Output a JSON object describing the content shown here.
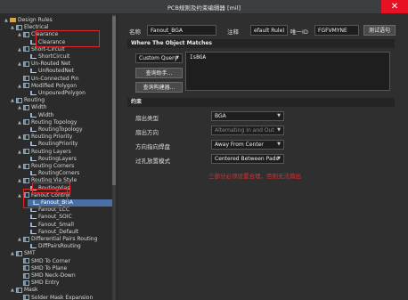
{
  "window": {
    "title": "PCB规则及约束编辑器 [mil]",
    "close_symbol": "✕"
  },
  "tree": [
    {
      "label": "Design Rules",
      "level": 0,
      "twisty": "▲",
      "icon": "folder-icon"
    },
    {
      "label": "Electrical",
      "level": 1,
      "twisty": "▲",
      "icon": "category-icon"
    },
    {
      "label": "Clearance",
      "level": 2,
      "twisty": "▲",
      "icon": "rule-category-icon"
    },
    {
      "label": "Clearance",
      "level": 3,
      "twisty": "",
      "icon": "rule-icon"
    },
    {
      "label": "Short-Circuit",
      "level": 2,
      "twisty": "▲",
      "icon": "rule-category-icon"
    },
    {
      "label": "ShortCircuit",
      "level": 3,
      "twisty": "",
      "icon": "rule-icon"
    },
    {
      "label": "Un-Routed Net",
      "level": 2,
      "twisty": "▲",
      "icon": "rule-category-icon"
    },
    {
      "label": "UnRoutedNet",
      "level": 3,
      "twisty": "",
      "icon": "rule-icon"
    },
    {
      "label": "Un-Connected Pin",
      "level": 2,
      "twisty": "",
      "icon": "rule-category-icon"
    },
    {
      "label": "Modified Polygon",
      "level": 2,
      "twisty": "▲",
      "icon": "rule-category-icon"
    },
    {
      "label": "UnpouredPolygon",
      "level": 3,
      "twisty": "",
      "icon": "rule-icon"
    },
    {
      "label": "Routing",
      "level": 1,
      "twisty": "▲",
      "icon": "category-icon"
    },
    {
      "label": "Width",
      "level": 2,
      "twisty": "▲",
      "icon": "rule-category-icon"
    },
    {
      "label": "Width",
      "level": 3,
      "twisty": "",
      "icon": "rule-icon"
    },
    {
      "label": "Routing Topology",
      "level": 2,
      "twisty": "▲",
      "icon": "rule-category-icon"
    },
    {
      "label": "RoutingTopology",
      "level": 3,
      "twisty": "",
      "icon": "rule-icon"
    },
    {
      "label": "Routing Priority",
      "level": 2,
      "twisty": "▲",
      "icon": "rule-category-icon"
    },
    {
      "label": "RoutingPriority",
      "level": 3,
      "twisty": "",
      "icon": "rule-icon"
    },
    {
      "label": "Routing Layers",
      "level": 2,
      "twisty": "▲",
      "icon": "rule-category-icon"
    },
    {
      "label": "RoutingLayers",
      "level": 3,
      "twisty": "",
      "icon": "rule-icon"
    },
    {
      "label": "Routing Corners",
      "level": 2,
      "twisty": "▲",
      "icon": "rule-category-icon"
    },
    {
      "label": "RoutingCorners",
      "level": 3,
      "twisty": "",
      "icon": "rule-icon"
    },
    {
      "label": "Routing Via Style",
      "level": 2,
      "twisty": "▲",
      "icon": "rule-category-icon"
    },
    {
      "label": "RoutingVias",
      "level": 3,
      "twisty": "",
      "icon": "rule-icon"
    },
    {
      "label": "Fanout Control",
      "level": 2,
      "twisty": "▲",
      "icon": "rule-category-icon"
    },
    {
      "label": "Fanout_BGA",
      "level": 3,
      "twisty": "",
      "icon": "rule-icon",
      "selected": true
    },
    {
      "label": "Fanout_LCC",
      "level": 3,
      "twisty": "",
      "icon": "rule-icon"
    },
    {
      "label": "Fanout_SOIC",
      "level": 3,
      "twisty": "",
      "icon": "rule-icon"
    },
    {
      "label": "Fanout_Small",
      "level": 3,
      "twisty": "",
      "icon": "rule-icon"
    },
    {
      "label": "Fanout_Default",
      "level": 3,
      "twisty": "",
      "icon": "rule-icon"
    },
    {
      "label": "Differential Pairs Routing",
      "level": 2,
      "twisty": "▲",
      "icon": "rule-category-icon"
    },
    {
      "label": "DiffPairsRouting",
      "level": 3,
      "twisty": "",
      "icon": "rule-icon"
    },
    {
      "label": "SMT",
      "level": 1,
      "twisty": "▲",
      "icon": "category-icon"
    },
    {
      "label": "SMD To Corner",
      "level": 2,
      "twisty": "",
      "icon": "rule-category-icon"
    },
    {
      "label": "SMD To Plane",
      "level": 2,
      "twisty": "",
      "icon": "rule-category-icon"
    },
    {
      "label": "SMD Neck-Down",
      "level": 2,
      "twisty": "",
      "icon": "rule-category-icon"
    },
    {
      "label": "SMD Entry",
      "level": 2,
      "twisty": "",
      "icon": "rule-category-icon"
    },
    {
      "label": "Mask",
      "level": 1,
      "twisty": "▲",
      "icon": "category-icon"
    },
    {
      "label": "Solder Mask Expansion",
      "level": 2,
      "twisty": "",
      "icon": "rule-category-icon"
    }
  ],
  "header": {
    "name_label": "名称",
    "name_value": "Fanout_BGA",
    "comment_label": "注释",
    "comment_value": "efault Rule)",
    "uid_label": "唯一ID",
    "uid_value": "FGFVMYNE",
    "test_button": "测试语句"
  },
  "matches": {
    "title": "Where The Object Matches",
    "query_type": "Custom Query",
    "query_text": "IsBGA",
    "assistant_button": "查询助手...",
    "builder_button": "查询构建器..."
  },
  "constraints": {
    "title": "约束",
    "rows": [
      {
        "label": "扇出类型",
        "value": "BGA",
        "enabled": true
      },
      {
        "label": "扇出方向",
        "value": "Alternating In and Out",
        "enabled": false
      },
      {
        "label": "方向指向焊盘",
        "value": "Away From Center",
        "enabled": true
      },
      {
        "label": "过孔放置模式",
        "value": "Centered Between Pads",
        "enabled": true
      }
    ],
    "note": "三部分必须设置合理，否则无法扇出"
  }
}
